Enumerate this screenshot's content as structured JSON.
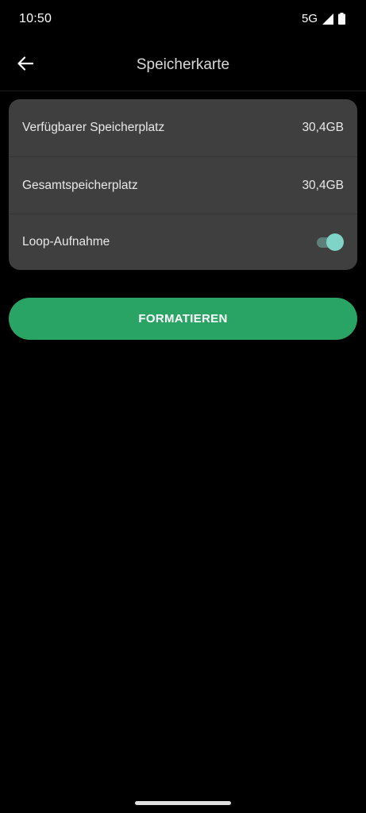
{
  "status_bar": {
    "time": "10:50",
    "network": "5G",
    "icons": [
      "signal-icon",
      "battery-icon"
    ]
  },
  "app_bar": {
    "title": "Speicherkarte",
    "back_icon": "arrow-left-icon"
  },
  "settings": {
    "rows": [
      {
        "label": "Verfügbarer Speicherplatz",
        "value": "30,4GB"
      },
      {
        "label": "Gesamtspeicherplatz",
        "value": "30,4GB"
      },
      {
        "label": "Loop-Aufnahme",
        "toggle_on": true
      }
    ]
  },
  "format_button": {
    "label": "FORMATIEREN"
  },
  "colors": {
    "background": "#000000",
    "card": "#3f3f3f",
    "accent_green": "#2aa465",
    "toggle_thumb": "#7fd3c7",
    "toggle_track": "#5d7f7a"
  }
}
